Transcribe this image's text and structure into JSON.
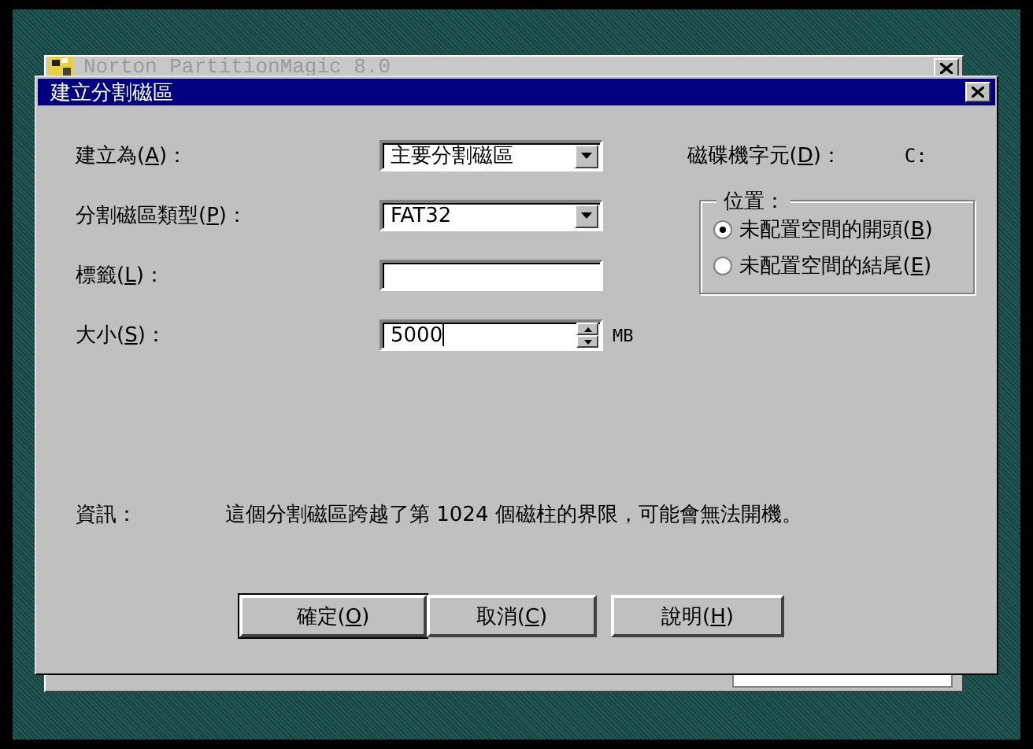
{
  "background_window": {
    "title": "Norton PartitionMagic 8.0"
  },
  "dialog": {
    "title": "建立分割磁區",
    "fields": [
      {
        "kind": "dropdown",
        "label": {
          "pre": "建立為(",
          "key": "A",
          "post": ")："
        },
        "value": "主要分割磁區"
      },
      {
        "kind": "dropdown",
        "label": {
          "pre": "分割磁區類型(",
          "key": "P",
          "post": ")："
        },
        "value": "FAT32"
      },
      {
        "kind": "text",
        "label": {
          "pre": "標籤(",
          "key": "L",
          "post": ")："
        }
      },
      {
        "kind": "spinner",
        "label": {
          "pre": "大小(",
          "key": "S",
          "post": ")："
        },
        "value": "5000",
        "unit": "MB"
      }
    ],
    "drive_letter": {
      "label": {
        "pre": "磁碟機字元(",
        "key": "D",
        "post": ")："
      },
      "value": "C:"
    },
    "position_group": {
      "title": "位置：",
      "options": [
        {
          "label": {
            "pre": "未配置空間的開頭(",
            "key": "B",
            "post": ")"
          },
          "selected": true
        },
        {
          "label": {
            "pre": "未配置空間的結尾(",
            "key": "E",
            "post": ")"
          },
          "selected": false
        }
      ]
    },
    "info": {
      "label": "資訊：",
      "text": "這個分割磁區跨越了第 1024 個磁柱的界限，可能會無法開機。"
    },
    "buttons": [
      {
        "label": {
          "pre": "確定(",
          "key": "O",
          "post": ")"
        },
        "default": true
      },
      {
        "label": {
          "pre": "取消(",
          "key": "C",
          "post": ")"
        },
        "default": false
      },
      {
        "label": {
          "pre": "說明(",
          "key": "H",
          "post": ")"
        },
        "default": false
      }
    ]
  }
}
